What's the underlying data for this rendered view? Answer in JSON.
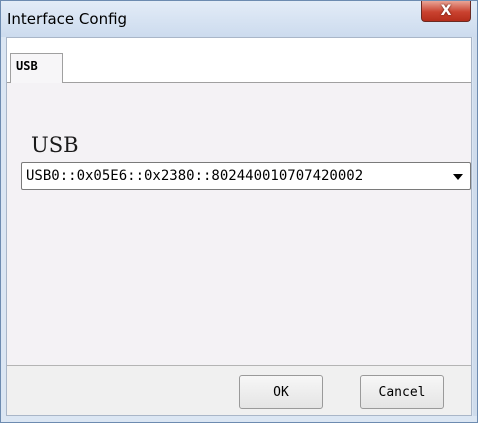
{
  "window": {
    "title": "Interface Config",
    "close_glyph": "X"
  },
  "tabs": [
    {
      "label": "USB",
      "selected": true
    }
  ],
  "usb_section": {
    "label": "USB",
    "selected_resource": "USB0::0x05E6::0x2380::802440010707420002"
  },
  "buttons": {
    "ok": "OK",
    "cancel": "Cancel"
  },
  "icons": {
    "close": "close-icon",
    "dropdown": "chevron-down-icon"
  },
  "colors": {
    "titlebar": "#d6e3f2",
    "close_button": "#c9422f",
    "client_background": "#f4f2f5"
  }
}
